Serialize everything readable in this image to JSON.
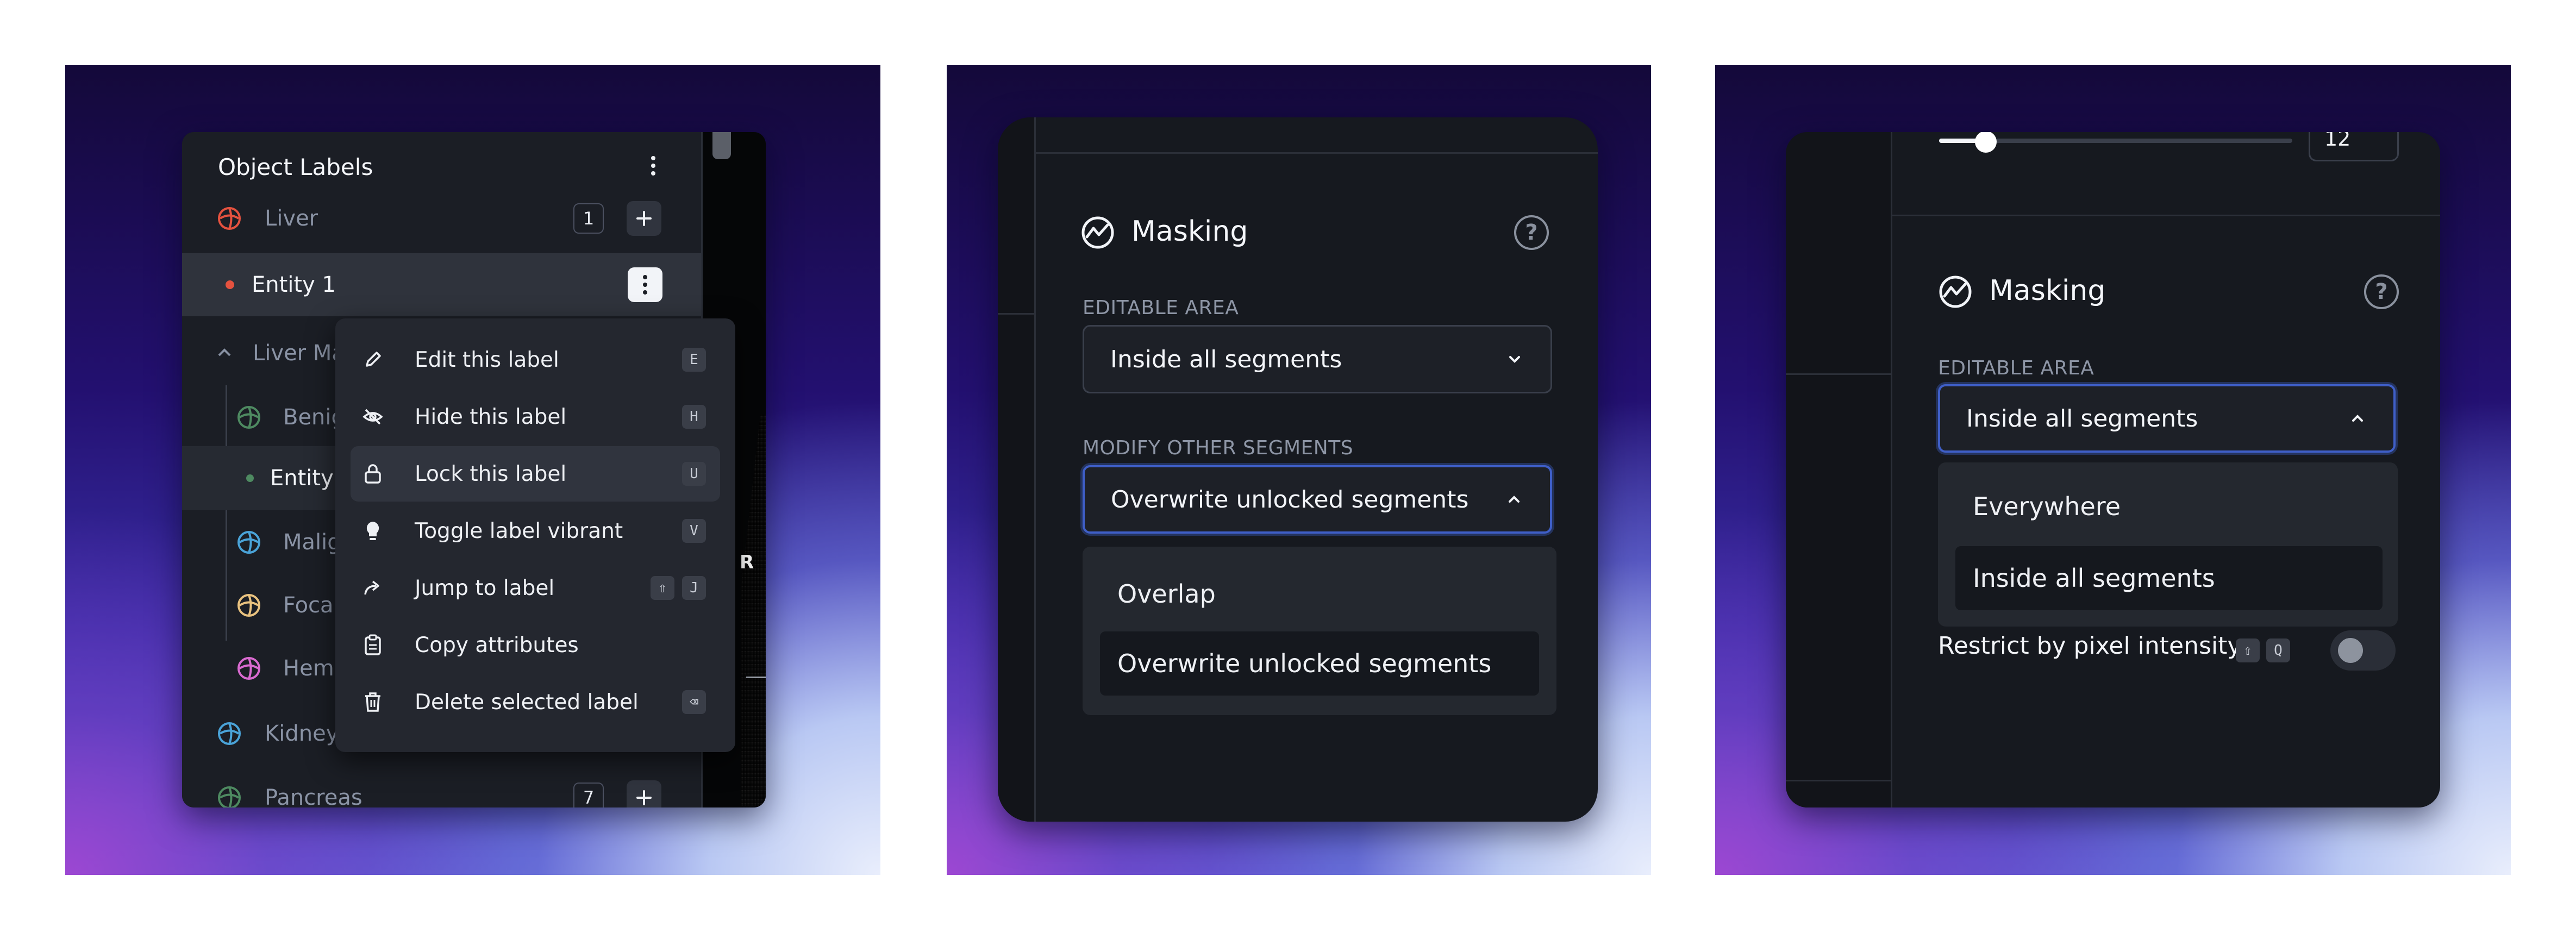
{
  "panel1": {
    "header_title": "Object Labels",
    "rows": [
      {
        "label": "Liver",
        "count": "1"
      },
      {
        "label": "Entity 1"
      },
      {
        "label": "Liver Ma"
      },
      {
        "label": "Benig"
      },
      {
        "label": "Entity"
      },
      {
        "label": "Malig"
      },
      {
        "label": "Foca"
      },
      {
        "label": "Hem"
      },
      {
        "label": "Kidney"
      },
      {
        "label": "Pancreas",
        "count": "7"
      }
    ],
    "viewer_marker": "R",
    "context_menu": [
      {
        "label": "Edit this label",
        "shortcut": "E"
      },
      {
        "label": "Hide this label",
        "shortcut": "H"
      },
      {
        "label": "Lock this label",
        "shortcut": "U"
      },
      {
        "label": "Toggle label vibrant",
        "shortcut": "V"
      },
      {
        "label": "Jump to label",
        "shortcut_mod": "⇧",
        "shortcut": "J"
      },
      {
        "label": "Copy attributes"
      },
      {
        "label": "Delete selected label",
        "shortcut": "⌫"
      }
    ],
    "colors": {
      "liver": "#e5523f",
      "entity_dot": "#e5523f",
      "benign": "#4e8a61",
      "malig": "#4aa3d8",
      "focal": "#e9c27f",
      "hem": "#d96ad0",
      "kidney": "#4aa3d8",
      "pancreas": "#4e8a61"
    }
  },
  "panel2": {
    "section_title": "Masking",
    "help": "?",
    "editable_area_label": "EDITABLE AREA",
    "editable_area_value": "Inside all segments",
    "modify_label": "MODIFY OTHER SEGMENTS",
    "modify_value": "Overwrite unlocked segments",
    "options": [
      "Overlap",
      "Overwrite unlocked segments"
    ],
    "selected_option": "Overwrite unlocked segments"
  },
  "panel3": {
    "slider_value": "12",
    "section_title": "Masking",
    "help": "?",
    "editable_area_label": "EDITABLE AREA",
    "editable_area_value": "Inside all segments",
    "options": [
      "Everywhere",
      "Inside all segments"
    ],
    "selected_option": "Inside all segments",
    "restrict_label": "Restrict by pixel intensity",
    "restrict_kbd_mod": "⇧",
    "restrict_kbd": "Q",
    "restrict_enabled": false
  }
}
